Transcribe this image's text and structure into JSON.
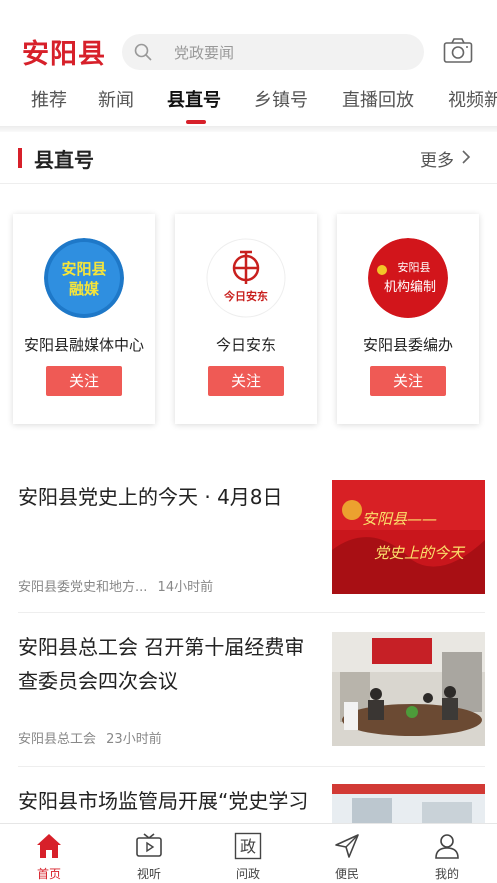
{
  "header": {
    "logo_text": "安阳县",
    "search_placeholder": "党政要闻",
    "search_icon": "search-icon",
    "camera_icon": "camera-icon"
  },
  "tabs": [
    "推荐",
    "新闻",
    "县直号",
    "乡镇号",
    "直播回放",
    "视频新"
  ],
  "active_tab": "县直号",
  "section": {
    "title": "县直号",
    "more": "更多"
  },
  "accounts": [
    {
      "name": "安阳县融媒体中心",
      "logo_text_1": "安阳县",
      "logo_text_2": "融媒",
      "follow": "关注"
    },
    {
      "name": "今日安东",
      "logo_text": "今日安东",
      "follow": "关注"
    },
    {
      "name": "安阳县委编办",
      "logo_text_1": "安阳县",
      "logo_text_2": "机构编制",
      "follow": "关注"
    }
  ],
  "news": [
    {
      "title": "安阳县党史上的今天 · 4月8日",
      "source": "安阳县委党史和地方...",
      "time": "14小时前",
      "thumb_text_1": "安阳县——",
      "thumb_text_2": "党史上的今天"
    },
    {
      "title": "安阳县总工会 召开第十届经费审查委员会四次会议",
      "source": "安阳县总工会",
      "time": "23小时前"
    },
    {
      "title": "安阳县市场监管局开展“党史学习教育”党史学习教育活"
    }
  ],
  "bottom_nav": [
    {
      "label": "首页",
      "icon": "home-icon",
      "active": true
    },
    {
      "label": "视听",
      "icon": "tv-play-icon",
      "active": false
    },
    {
      "label": "问政",
      "icon": "zheng-icon",
      "glyph": "政",
      "active": false
    },
    {
      "label": "便民",
      "icon": "send-icon",
      "active": false
    },
    {
      "label": "我的",
      "icon": "user-icon",
      "active": false
    }
  ],
  "colors": {
    "brand": "#d7202a",
    "follow_button": "#ef5a55"
  }
}
